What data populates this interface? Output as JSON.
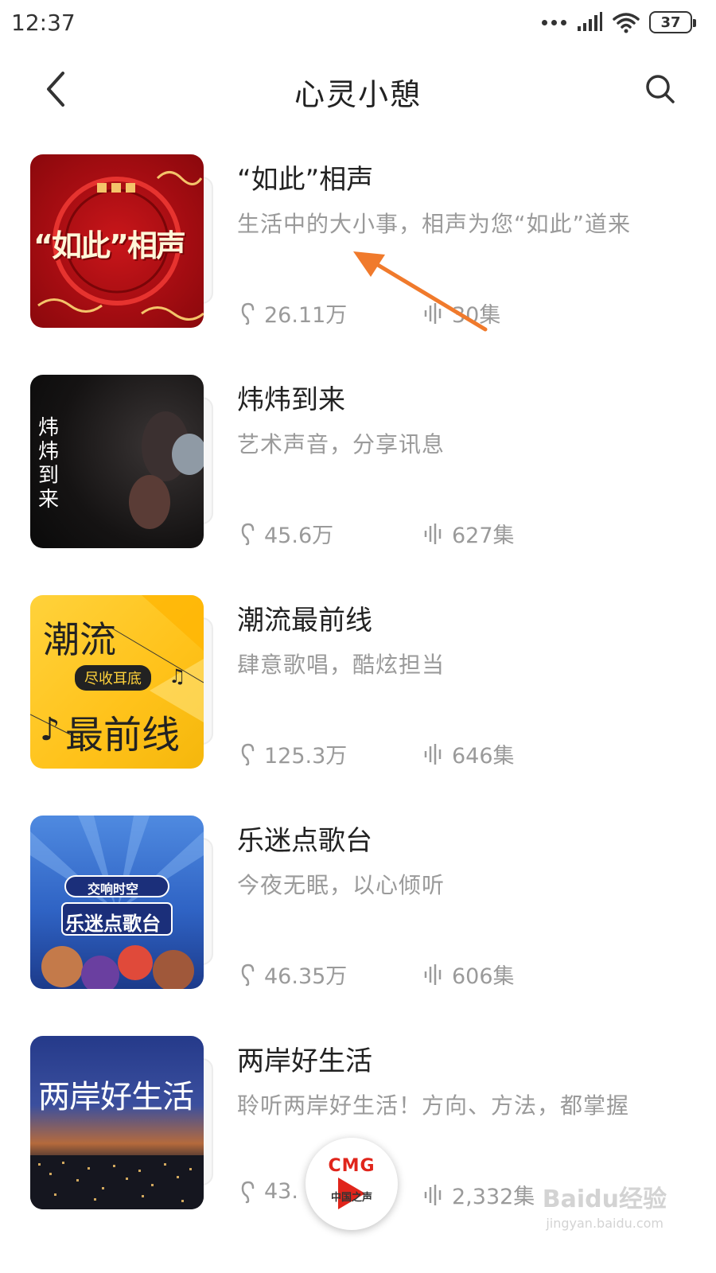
{
  "status_bar": {
    "time": "12:37",
    "battery": "37"
  },
  "header": {
    "title": "心灵小憩"
  },
  "items": [
    {
      "title": "“如此”相声",
      "description": "生活中的大小事，相声为您“如此”道来",
      "listens": "26.11万",
      "episodes": "30集",
      "cover_text": "“如此”相声",
      "cover_style": "cv-red"
    },
    {
      "title": "炜炜到来",
      "description": "艺术声音，分享讯息",
      "listens": "45.6万",
      "episodes": "627集",
      "cover_text": "炜炜到来",
      "cover_style": "cv-dark"
    },
    {
      "title": "潮流最前线",
      "description": "肆意歌唱，酷炫担当",
      "listens": "125.3万",
      "episodes": "646集",
      "cover_text_top": "潮流",
      "cover_badge": "尽收耳底",
      "cover_text_bottom": "最前线",
      "cover_style": "cv-yellow"
    },
    {
      "title": "乐迷点歌台",
      "description": "今夜无眠，以心倾听",
      "listens": "46.35万",
      "episodes": "606集",
      "cover_badge": "交响时空",
      "cover_text": "乐迷点歌台",
      "cover_style": "cv-blue"
    },
    {
      "title": "两岸好生活",
      "description": "聆听两岸好生活！方向、方法，都掌握",
      "listens": "43.",
      "episodes": "2,332集",
      "cover_text": "两岸好生活",
      "cover_style": "cv-city"
    }
  ],
  "player": {
    "logo": "CMG",
    "subtitle": "中国之声"
  },
  "watermark": {
    "text": "Baidu经验",
    "url": "jingyan.baidu.com"
  },
  "colors": {
    "accent_arrow": "#f07a2c",
    "muted_text": "#9a9a9a",
    "cmg_red": "#e0251b"
  }
}
